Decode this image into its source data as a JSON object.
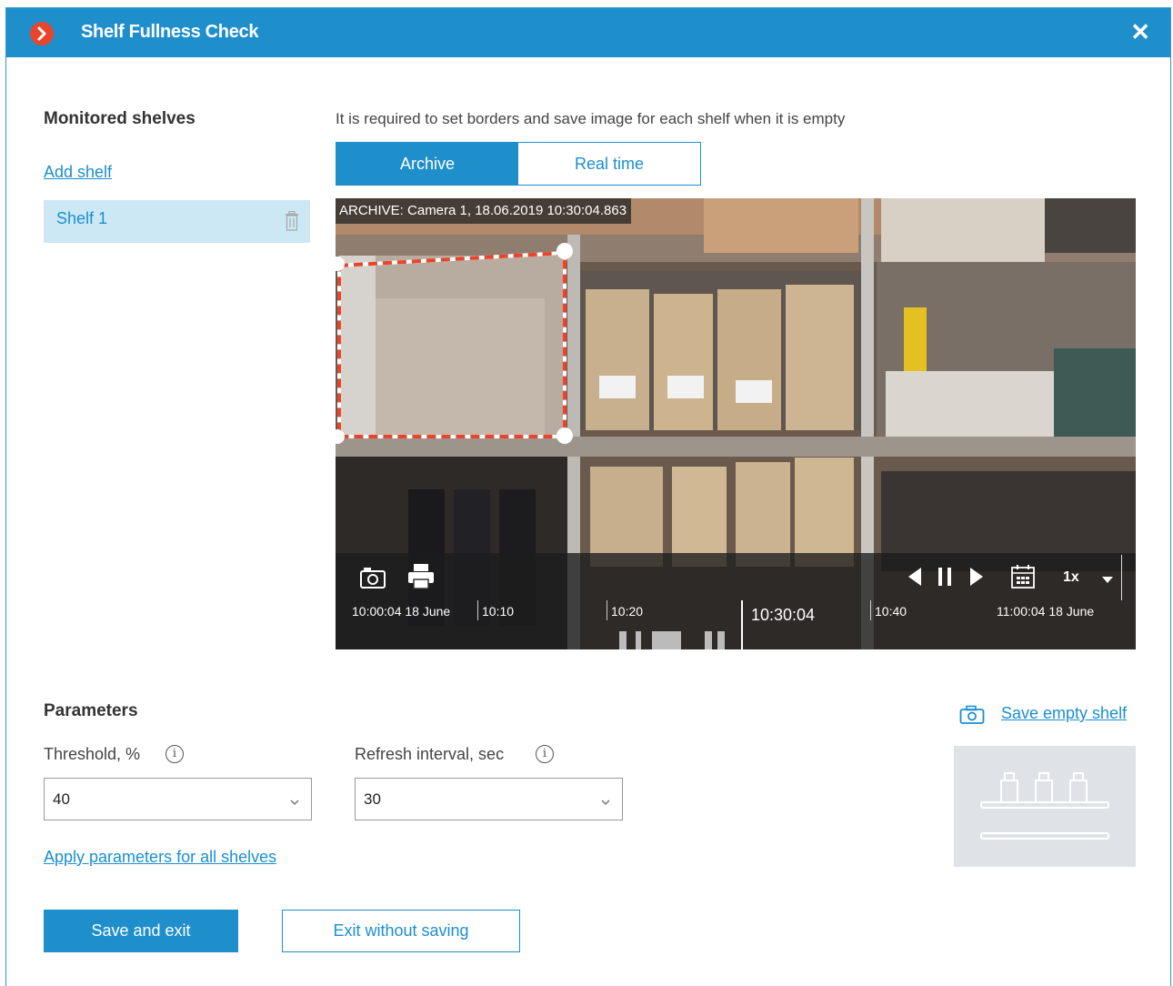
{
  "window": {
    "title": "Shelf Fullness Check",
    "close_icon": "close-icon"
  },
  "sidebar": {
    "heading": "Monitored shelves",
    "add_shelf_link": "Add shelf",
    "shelves": [
      {
        "label": "Shelf 1"
      }
    ]
  },
  "main": {
    "instruction": "It is required to set borders and save image for each shelf when it is empty",
    "tabs": [
      {
        "label": "Archive",
        "active": true
      },
      {
        "label": "Real time",
        "active": false
      }
    ],
    "video": {
      "osd": "ARCHIVE: Camera 1, 18.06.2019 10:30:04.863",
      "speed": "1x",
      "timeline": {
        "start": "10:00:04 18 June",
        "t1": "10:10",
        "t2": "10:20",
        "current": "10:30:04",
        "t3": "10:40",
        "end": "11:00:04 18 June"
      }
    }
  },
  "parameters": {
    "heading": "Parameters",
    "threshold": {
      "label": "Threshold, %",
      "value": "40"
    },
    "refresh": {
      "label": "Refresh interval, sec",
      "value": "30"
    },
    "apply_link": "Apply parameters for all shelves",
    "save_empty_link": "Save empty shelf"
  },
  "footer": {
    "save_label": "Save and exit",
    "exit_label": "Exit without saving"
  },
  "colors": {
    "accent": "#1f8fcb",
    "link": "#1a8fd0",
    "brand_icon": "#e8452c",
    "selection": "#cde8f5",
    "border_dash": "#e8452c"
  }
}
